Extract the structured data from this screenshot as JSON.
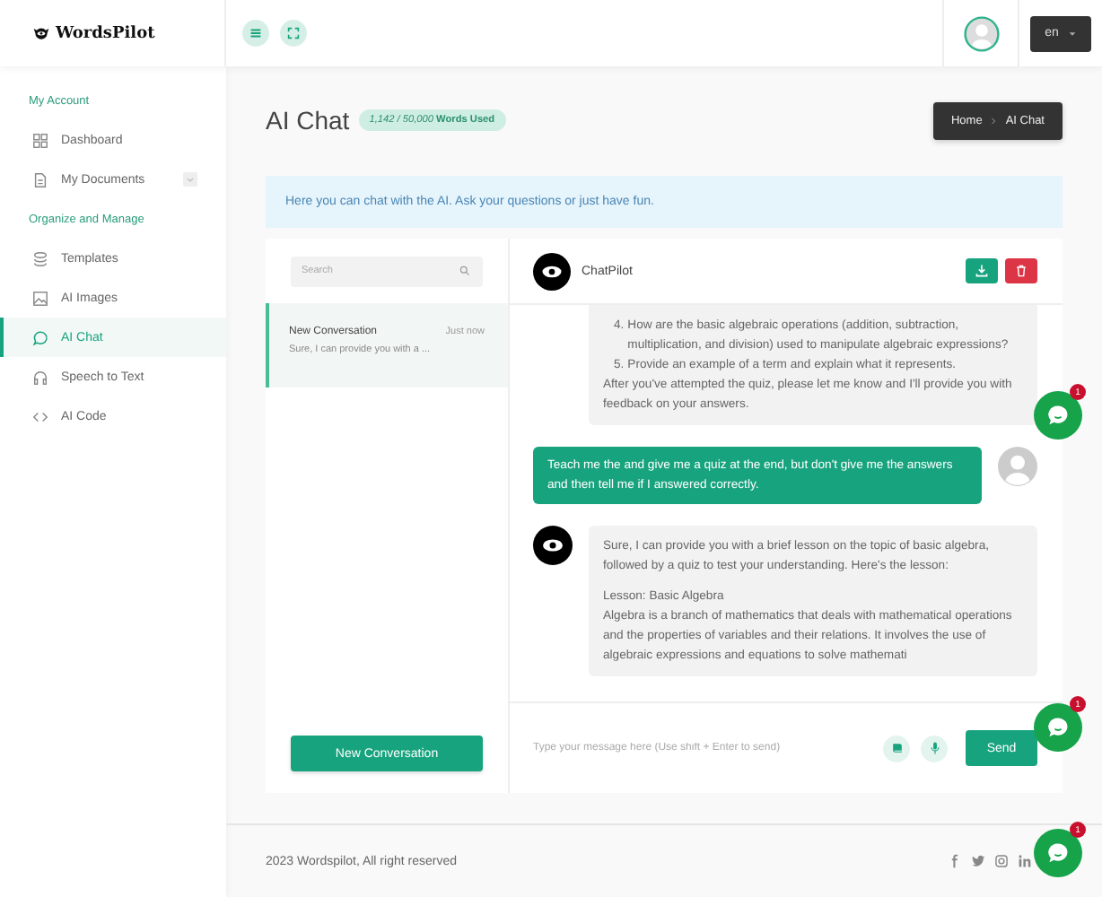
{
  "header": {
    "logo": "WordsPilot",
    "language": "en"
  },
  "sidebar": {
    "sections": [
      {
        "title": "My Account",
        "items": [
          {
            "label": "Dashboard",
            "selected": false,
            "expandable": false
          },
          {
            "label": "My Documents",
            "selected": false,
            "expandable": true
          }
        ]
      },
      {
        "title": "Organize and Manage",
        "items": [
          {
            "label": "Templates",
            "selected": false,
            "expandable": false
          },
          {
            "label": "AI Images",
            "selected": false,
            "expandable": false
          },
          {
            "label": "AI Chat",
            "selected": true,
            "expandable": false
          },
          {
            "label": "Speech to Text",
            "selected": false,
            "expandable": false
          },
          {
            "label": "AI Code",
            "selected": false,
            "expandable": false
          }
        ]
      }
    ]
  },
  "page": {
    "title": "AI Chat",
    "usage": "*1,142 / 50,000* **Words Used**",
    "breadcrumb": [
      "Home",
      "AI Chat"
    ],
    "info": "Here you can chat with the AI. Ask your questions or just have fun."
  },
  "conversations": {
    "search": {
      "placeholder": "Search"
    },
    "items": [
      {
        "title": "New Conversation",
        "time": "Just now",
        "preview": "Sure, I can provide you with a ...",
        "selected": true
      }
    ],
    "new_button": "New Conversation"
  },
  "chat": {
    "bot_name": "ChatPilot",
    "messages": [
      {
        "kind": "bot",
        "blocks": [
          {
            "kind": "item",
            "number": "4.",
            "text": "How are the basic algebraic operations (addition, subtraction, multiplication, and division) used to manipulate algebraic expressions?"
          },
          {
            "kind": "item",
            "number": "5.",
            "text": "Provide an example of a term and explain what it represents."
          },
          {
            "kind": "para",
            "text": "After you've attempted the quiz, please let me know and I'll provide you with feedback on your answers."
          }
        ]
      },
      {
        "kind": "user",
        "blocks": [
          {
            "kind": "para",
            "text": "Teach me the and give me a quiz at the end, but don't give me the answers and then tell me if I answered correctly."
          }
        ]
      },
      {
        "kind": "bot",
        "blocks": [
          {
            "kind": "para",
            "text": "Sure, I can provide you with a brief lesson on the topic of basic algebra, followed by a quiz to test your understanding. Here's the lesson:"
          },
          {
            "kind": "line",
            "text": "Lesson: Basic Algebra"
          },
          {
            "kind": "line",
            "text": "Algebra is a branch of mathematics that deals with mathematical operations and the properties of variables and their relations. It involves the use of algebraic expressions and equations to solve mathemati"
          }
        ]
      }
    ],
    "input": {
      "placeholder": "Type your message here (Use shift + Enter to send)"
    },
    "send_button": "Send"
  },
  "footer": {
    "copyright": "2023 Wordspilot, All right reserved"
  },
  "chat_widgets": [
    {
      "badge": "1"
    },
    {
      "badge": "1"
    },
    {
      "badge": "1"
    }
  ]
}
